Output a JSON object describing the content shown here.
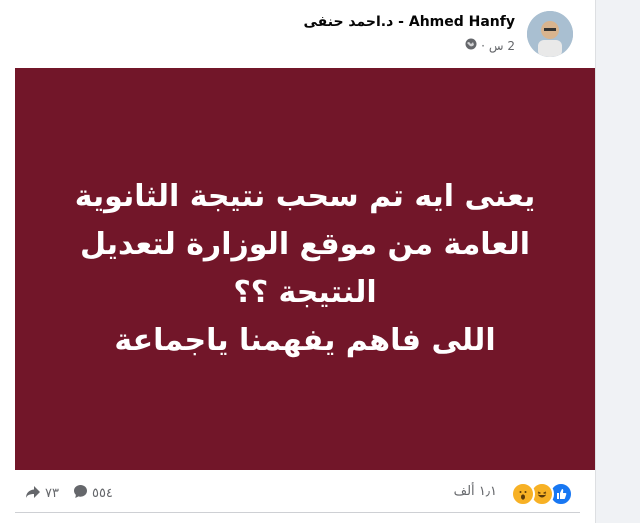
{
  "post": {
    "author_name": "Ahmed Hanfy - د.احمد حنفى",
    "timestamp": "2 س",
    "privacy_icon": "public-globe-icon",
    "image_text_lines": [
      "يعنى ايه تم سحب نتيجة الثانوية",
      "العامة من موقع الوزارة لتعديل",
      "النتيجة ؟؟",
      "اللى فاهم يفهمنا ياجماعة"
    ],
    "image_background": "#721629"
  },
  "reactions": {
    "icons": [
      "like-icon",
      "haha-icon",
      "wow-icon"
    ],
    "count": "١٫١ ألف"
  },
  "stats": {
    "comments": "٥٥٤",
    "shares": "٧٣"
  }
}
